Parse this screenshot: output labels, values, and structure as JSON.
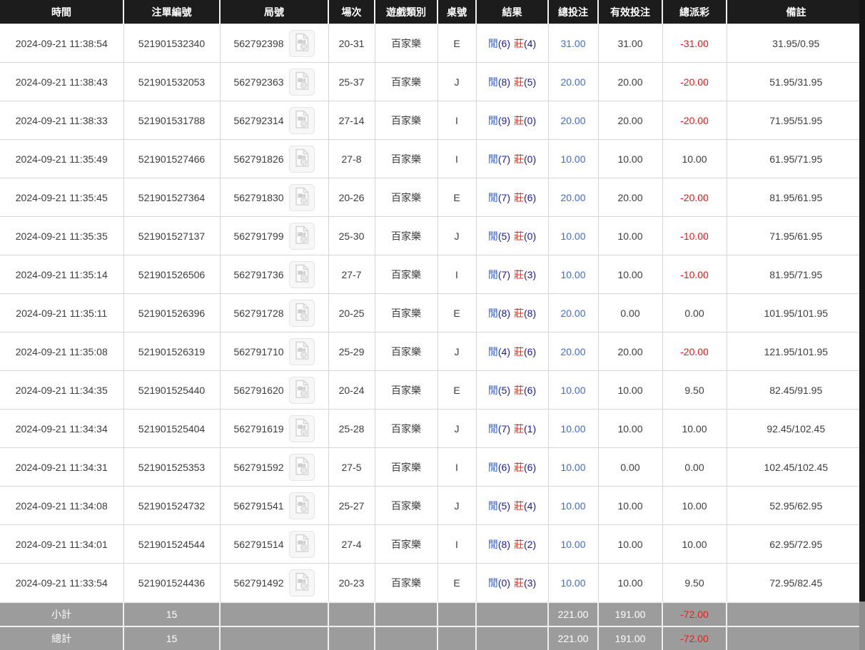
{
  "table": {
    "columns": [
      "時間",
      "注單編號",
      "局號",
      "場次",
      "遊戲類別",
      "桌號",
      "結果",
      "總投注",
      "有效投注",
      "總派彩",
      "備註"
    ],
    "rows": [
      {
        "time": "2024-09-21 11:38:54",
        "bet_id": "521901532340",
        "round_id": "562792398",
        "session": "20-31",
        "game_type": "百家樂",
        "table_no": "E",
        "result": {
          "player_label": "閒",
          "player_score": "(6)",
          "banker_label": "莊",
          "banker_score": "(4)"
        },
        "total_bet": "31.00",
        "valid_bet": "31.00",
        "payout": "-31.00",
        "remark": "31.95/0.95"
      },
      {
        "time": "2024-09-21 11:38:43",
        "bet_id": "521901532053",
        "round_id": "562792363",
        "session": "25-37",
        "game_type": "百家樂",
        "table_no": "J",
        "result": {
          "player_label": "閒",
          "player_score": "(8)",
          "banker_label": "莊",
          "banker_score": "(5)"
        },
        "total_bet": "20.00",
        "valid_bet": "20.00",
        "payout": "-20.00",
        "remark": "51.95/31.95"
      },
      {
        "time": "2024-09-21 11:38:33",
        "bet_id": "521901531788",
        "round_id": "562792314",
        "session": "27-14",
        "game_type": "百家樂",
        "table_no": "I",
        "result": {
          "player_label": "閒",
          "player_score": "(9)",
          "banker_label": "莊",
          "banker_score": "(0)"
        },
        "total_bet": "20.00",
        "valid_bet": "20.00",
        "payout": "-20.00",
        "remark": "71.95/51.95"
      },
      {
        "time": "2024-09-21 11:35:49",
        "bet_id": "521901527466",
        "round_id": "562791826",
        "session": "27-8",
        "game_type": "百家樂",
        "table_no": "I",
        "result": {
          "player_label": "閒",
          "player_score": "(7)",
          "banker_label": "莊",
          "banker_score": "(0)"
        },
        "total_bet": "10.00",
        "valid_bet": "10.00",
        "payout": "10.00",
        "remark": "61.95/71.95"
      },
      {
        "time": "2024-09-21 11:35:45",
        "bet_id": "521901527364",
        "round_id": "562791830",
        "session": "20-26",
        "game_type": "百家樂",
        "table_no": "E",
        "result": {
          "player_label": "閒",
          "player_score": "(7)",
          "banker_label": "莊",
          "banker_score": "(6)"
        },
        "total_bet": "20.00",
        "valid_bet": "20.00",
        "payout": "-20.00",
        "remark": "81.95/61.95"
      },
      {
        "time": "2024-09-21 11:35:35",
        "bet_id": "521901527137",
        "round_id": "562791799",
        "session": "25-30",
        "game_type": "百家樂",
        "table_no": "J",
        "result": {
          "player_label": "閒",
          "player_score": "(5)",
          "banker_label": "莊",
          "banker_score": "(0)"
        },
        "total_bet": "10.00",
        "valid_bet": "10.00",
        "payout": "-10.00",
        "remark": "71.95/61.95"
      },
      {
        "time": "2024-09-21 11:35:14",
        "bet_id": "521901526506",
        "round_id": "562791736",
        "session": "27-7",
        "game_type": "百家樂",
        "table_no": "I",
        "result": {
          "player_label": "閒",
          "player_score": "(7)",
          "banker_label": "莊",
          "banker_score": "(3)"
        },
        "total_bet": "10.00",
        "valid_bet": "10.00",
        "payout": "-10.00",
        "remark": "81.95/71.95"
      },
      {
        "time": "2024-09-21 11:35:11",
        "bet_id": "521901526396",
        "round_id": "562791728",
        "session": "20-25",
        "game_type": "百家樂",
        "table_no": "E",
        "result": {
          "player_label": "閒",
          "player_score": "(8)",
          "banker_label": "莊",
          "banker_score": "(8)"
        },
        "total_bet": "20.00",
        "valid_bet": "0.00",
        "payout": "0.00",
        "remark": "101.95/101.95"
      },
      {
        "time": "2024-09-21 11:35:08",
        "bet_id": "521901526319",
        "round_id": "562791710",
        "session": "25-29",
        "game_type": "百家樂",
        "table_no": "J",
        "result": {
          "player_label": "閒",
          "player_score": "(4)",
          "banker_label": "莊",
          "banker_score": "(6)"
        },
        "total_bet": "20.00",
        "valid_bet": "20.00",
        "payout": "-20.00",
        "remark": "121.95/101.95"
      },
      {
        "time": "2024-09-21 11:34:35",
        "bet_id": "521901525440",
        "round_id": "562791620",
        "session": "20-24",
        "game_type": "百家樂",
        "table_no": "E",
        "result": {
          "player_label": "閒",
          "player_score": "(5)",
          "banker_label": "莊",
          "banker_score": "(6)"
        },
        "total_bet": "10.00",
        "valid_bet": "10.00",
        "payout": "9.50",
        "remark": "82.45/91.95"
      },
      {
        "time": "2024-09-21 11:34:34",
        "bet_id": "521901525404",
        "round_id": "562791619",
        "session": "25-28",
        "game_type": "百家樂",
        "table_no": "J",
        "result": {
          "player_label": "閒",
          "player_score": "(7)",
          "banker_label": "莊",
          "banker_score": "(1)"
        },
        "total_bet": "10.00",
        "valid_bet": "10.00",
        "payout": "10.00",
        "remark": "92.45/102.45"
      },
      {
        "time": "2024-09-21 11:34:31",
        "bet_id": "521901525353",
        "round_id": "562791592",
        "session": "27-5",
        "game_type": "百家樂",
        "table_no": "I",
        "result": {
          "player_label": "閒",
          "player_score": "(6)",
          "banker_label": "莊",
          "banker_score": "(6)"
        },
        "total_bet": "10.00",
        "valid_bet": "0.00",
        "payout": "0.00",
        "remark": "102.45/102.45"
      },
      {
        "time": "2024-09-21 11:34:08",
        "bet_id": "521901524732",
        "round_id": "562791541",
        "session": "25-27",
        "game_type": "百家樂",
        "table_no": "J",
        "result": {
          "player_label": "閒",
          "player_score": "(5)",
          "banker_label": "莊",
          "banker_score": "(4)"
        },
        "total_bet": "10.00",
        "valid_bet": "10.00",
        "payout": "10.00",
        "remark": "52.95/62.95"
      },
      {
        "time": "2024-09-21 11:34:01",
        "bet_id": "521901524544",
        "round_id": "562791514",
        "session": "27-4",
        "game_type": "百家樂",
        "table_no": "I",
        "result": {
          "player_label": "閒",
          "player_score": "(8)",
          "banker_label": "莊",
          "banker_score": "(2)"
        },
        "total_bet": "10.00",
        "valid_bet": "10.00",
        "payout": "10.00",
        "remark": "62.95/72.95"
      },
      {
        "time": "2024-09-21 11:33:54",
        "bet_id": "521901524436",
        "round_id": "562791492",
        "session": "20-23",
        "game_type": "百家樂",
        "table_no": "E",
        "result": {
          "player_label": "閒",
          "player_score": "(0)",
          "banker_label": "莊",
          "banker_score": "(3)"
        },
        "total_bet": "10.00",
        "valid_bet": "10.00",
        "payout": "9.50",
        "remark": "72.95/82.45"
      }
    ],
    "footer": {
      "subtotal": {
        "label": "小計",
        "count": "15",
        "total_bet": "221.00",
        "valid_bet": "191.00",
        "payout": "-72.00"
      },
      "total": {
        "label": "總計",
        "count": "15",
        "total_bet": "221.00",
        "valid_bet": "191.00",
        "payout": "-72.00"
      }
    }
  },
  "icons": {
    "video": "video-replay-icon"
  },
  "colors": {
    "header_bg": "#1c1c1c",
    "footer_bg": "#9c9c9c",
    "link_blue": "#3d6be0",
    "player_blue": "#2f62d8",
    "banker_red": "#e03224",
    "score_navy": "#1b1b99",
    "negative_red": "#f01414"
  }
}
